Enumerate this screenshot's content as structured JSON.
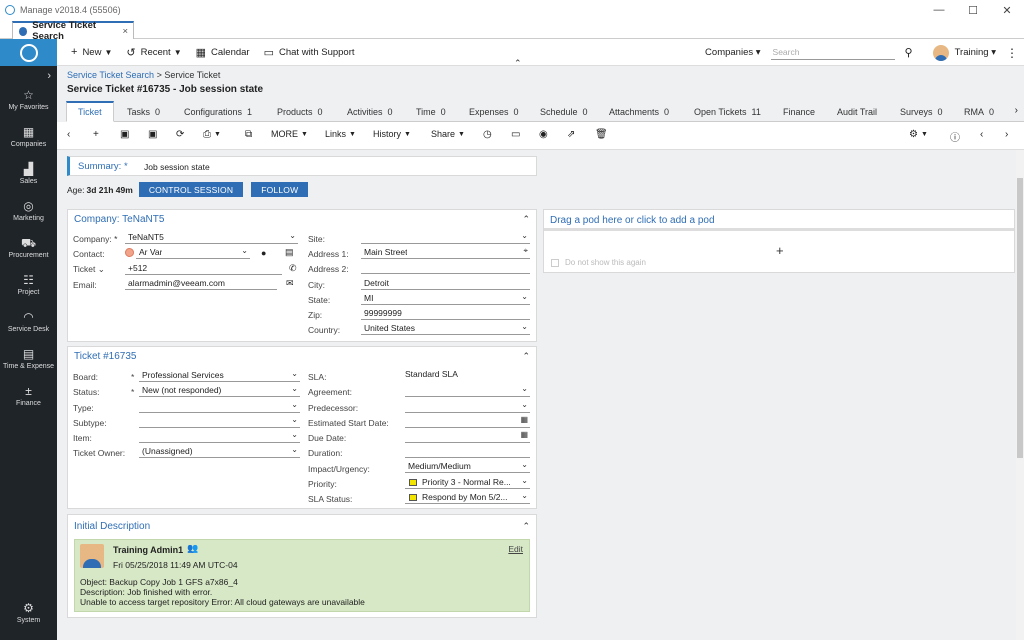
{
  "window": {
    "title": "Manage v2018.4 (55506)",
    "minimize": "—",
    "maximize": "☐",
    "close": "✕"
  },
  "doc_tab": {
    "label": "Service Ticket Search",
    "close": "×"
  },
  "topbar": {
    "new": "New",
    "recent": "Recent",
    "calendar": "Calendar",
    "chat": "Chat with Support",
    "companies": "Companies",
    "search_placeholder": "Search",
    "user": "Training"
  },
  "leftnav": {
    "items": [
      {
        "label": "My Favorites",
        "icon": "star-icon"
      },
      {
        "label": "Companies",
        "icon": "building-icon"
      },
      {
        "label": "Sales",
        "icon": "chart-icon"
      },
      {
        "label": "Marketing",
        "icon": "target-icon"
      },
      {
        "label": "Procurement",
        "icon": "cart-icon"
      },
      {
        "label": "Project",
        "icon": "project-icon"
      },
      {
        "label": "Service Desk",
        "icon": "headset-icon"
      },
      {
        "label": "Time & Expense",
        "icon": "clock-icon"
      },
      {
        "label": "Finance",
        "icon": "calculator-icon"
      }
    ],
    "system": "System"
  },
  "breadcrumb": {
    "link": "Service Ticket Search",
    "sep": ">",
    "current": "Service Ticket"
  },
  "page_title": "Service Ticket #16735 - Job session state",
  "subtabs": [
    {
      "label": "Ticket",
      "count": ""
    },
    {
      "label": "Tasks",
      "count": "0"
    },
    {
      "label": "Configurations",
      "count": "1"
    },
    {
      "label": "Products",
      "count": "0"
    },
    {
      "label": "Activities",
      "count": "0"
    },
    {
      "label": "Time",
      "count": "0"
    },
    {
      "label": "Expenses",
      "count": "0"
    },
    {
      "label": "Schedule",
      "count": "0"
    },
    {
      "label": "Attachments",
      "count": "0"
    },
    {
      "label": "Open Tickets",
      "count": "11"
    },
    {
      "label": "Finance",
      "count": ""
    },
    {
      "label": "Audit Trail",
      "count": ""
    },
    {
      "label": "Surveys",
      "count": "0"
    },
    {
      "label": "RMA",
      "count": "0"
    }
  ],
  "actions": {
    "more": "MORE",
    "links": "Links",
    "history": "History",
    "share": "Share"
  },
  "summary": {
    "label": "Summary:",
    "req": "*",
    "value": "Job session state"
  },
  "age": {
    "label": "Age:",
    "value": "3d 21h 49m",
    "control_session": "CONTROL SESSION",
    "follow": "FOLLOW"
  },
  "company_panel": {
    "title": "Company: TeNaNT5",
    "company_label": "Company:",
    "company_value": "TeNaNT5",
    "contact_label": "Contact:",
    "contact_value": "Ar Var",
    "ticket_label": "Ticket",
    "ticket_value": "+512",
    "email_label": "Email:",
    "email_value": "alarmadmin@veeam.com",
    "site_label": "Site:",
    "site_value": "",
    "address1_label": "Address 1:",
    "address1_value": "Main Street",
    "address2_label": "Address 2:",
    "address2_value": "",
    "city_label": "City:",
    "city_value": "Detroit",
    "state_label": "State:",
    "state_value": "MI",
    "zip_label": "Zip:",
    "zip_value": "99999999",
    "country_label": "Country:",
    "country_value": "United States"
  },
  "ticket_panel": {
    "title": "Ticket #16735",
    "board_label": "Board:",
    "board_value": "Professional Services",
    "status_label": "Status:",
    "status_value": "New (not responded)",
    "type_label": "Type:",
    "subtype_label": "Subtype:",
    "item_label": "Item:",
    "owner_label": "Ticket Owner:",
    "owner_value": "(Unassigned)",
    "sla_label": "SLA:",
    "sla_value": "Standard SLA",
    "agreement_label": "Agreement:",
    "predecessor_label": "Predecessor:",
    "est_start_label": "Estimated Start Date:",
    "due_label": "Due Date:",
    "duration_label": "Duration:",
    "impact_label": "Impact/Urgency:",
    "impact_value": "Medium/Medium",
    "priority_label": "Priority:",
    "priority_value": "Priority 3 - Normal Re...",
    "sla_status_label": "SLA Status:",
    "sla_status_value": "Respond by Mon 5/2...",
    "priority_color": "#f2e600"
  },
  "pod": {
    "title": "Drag a pod here or click to add a pod",
    "plus": "+",
    "checkbox": "Do not show this again"
  },
  "description": {
    "title": "Initial Description",
    "author": "Training Admin1",
    "date": "Fri 05/25/2018 11:49 AM UTC-04",
    "edit": "Edit",
    "lines": [
      "Object: Backup Copy Job 1 GFS a7x86_4",
      "Description: Job finished with error.",
      "Unable to access target repository Error: All cloud gateways are unavailable"
    ]
  }
}
